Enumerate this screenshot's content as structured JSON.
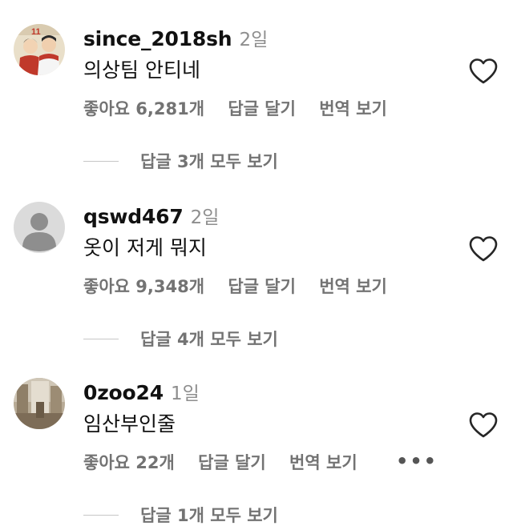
{
  "comments": [
    {
      "username": "since_2018sh",
      "time": "2일",
      "text": "의상팀 안티네",
      "likes": "좋아요 6,281개",
      "reply": "답글 달기",
      "translate": "번역 보기",
      "view_replies": "답글 3개 모두 보기",
      "avatar_icon": "comic-character-avatar"
    },
    {
      "username": "qswd467",
      "time": "2일",
      "text": "옷이 저게 뭐지",
      "likes": "좋아요 9,348개",
      "reply": "답글 달기",
      "translate": "번역 보기",
      "view_replies": "답글 4개 모두 보기",
      "avatar_icon": "default-user-avatar"
    },
    {
      "username": "0zoo24",
      "time": "1일",
      "text": "임산부인줄",
      "likes": "좋아요 22개",
      "reply": "답글 달기",
      "translate": "번역 보기",
      "more": "•••",
      "view_replies": "답글 1개 모두 보기",
      "avatar_icon": "photo-avatar"
    }
  ],
  "colors": {
    "text": "#111111",
    "secondary": "#737373",
    "time": "#8e8e8e"
  }
}
